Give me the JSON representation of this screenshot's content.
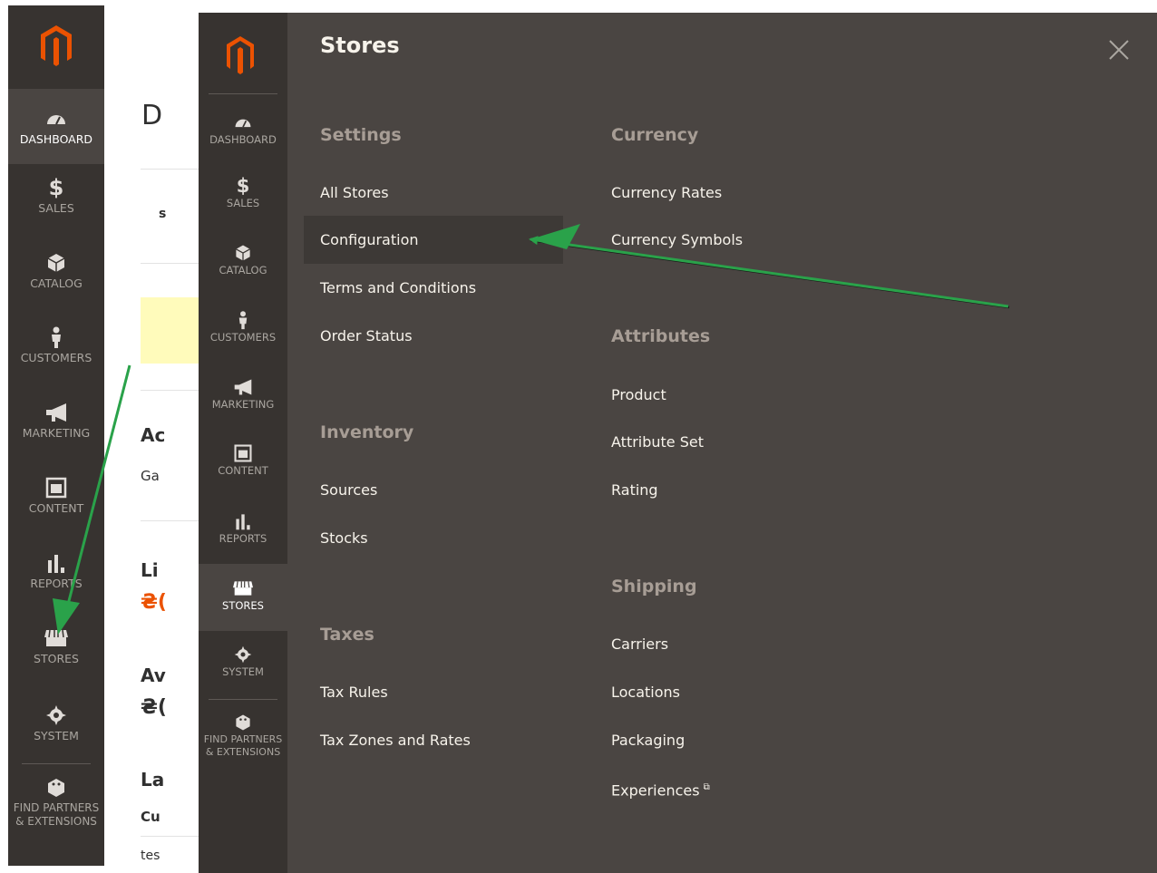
{
  "main_nav": [
    {
      "label": "DASHBOARD",
      "icon": "dashboard-icon"
    },
    {
      "label": "SALES",
      "icon": "dollar-icon"
    },
    {
      "label": "CATALOG",
      "icon": "cube-icon"
    },
    {
      "label": "CUSTOMERS",
      "icon": "person-icon"
    },
    {
      "label": "MARKETING",
      "icon": "megaphone-icon"
    },
    {
      "label": "CONTENT",
      "icon": "layout-icon"
    },
    {
      "label": "REPORTS",
      "icon": "bar-chart-icon"
    },
    {
      "label": "STORES",
      "icon": "store-icon"
    },
    {
      "label": "SYSTEM",
      "icon": "gear-icon"
    },
    {
      "label": "FIND PARTNERS & EXTENSIONS",
      "icon": "blocks-icon"
    }
  ],
  "dashboard_fragments": {
    "heading": "D",
    "s": "s",
    "ac": "Ac",
    "ga": "Ga",
    "li": "Li",
    "amount1": "₴(",
    "av": "Av",
    "amount2": "₴(",
    "la": "La",
    "cu": "Cu",
    "tes": "tes"
  },
  "panel": {
    "title": "Stores",
    "close_icon": "close-icon",
    "sections": {
      "settings": {
        "title": "Settings",
        "links": [
          "All Stores",
          "Configuration",
          "Terms and Conditions",
          "Order Status"
        ]
      },
      "inventory": {
        "title": "Inventory",
        "links": [
          "Sources",
          "Stocks"
        ]
      },
      "taxes": {
        "title": "Taxes",
        "links": [
          "Tax Rules",
          "Tax Zones and Rates"
        ]
      },
      "currency": {
        "title": "Currency",
        "links": [
          "Currency Rates",
          "Currency Symbols"
        ]
      },
      "attributes": {
        "title": "Attributes",
        "links": [
          "Product",
          "Attribute Set",
          "Rating"
        ]
      },
      "shipping": {
        "title": "Shipping",
        "links": [
          "Carriers",
          "Locations",
          "Packaging",
          "Experiences"
        ]
      }
    }
  },
  "colors": {
    "sidebar_bg": "#373330",
    "panel_bg": "#4a4542",
    "brand_orange": "#eb5202",
    "arrow_green": "#2aa24a"
  }
}
